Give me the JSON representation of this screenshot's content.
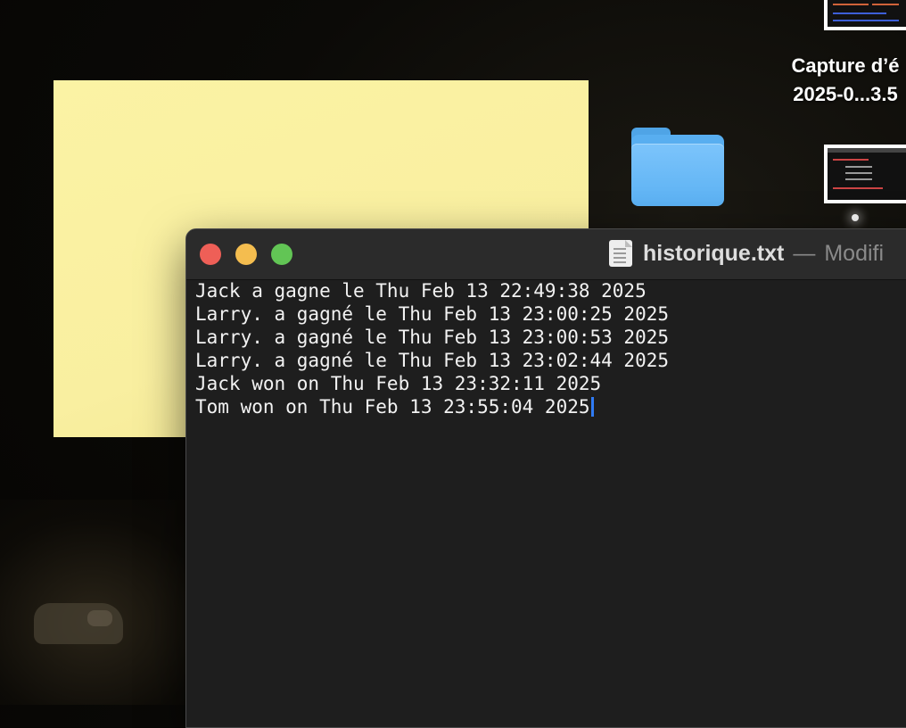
{
  "desktop": {
    "file_label_line1": "Capture d’é",
    "file_label_line2": "2025-0...3.5",
    "folder_icon": "folder-icon",
    "colors": {
      "sticky": "#fbf3a4",
      "folder": "#5bb1f3"
    }
  },
  "window": {
    "filename": "historique.txt",
    "separator": "—",
    "status": "Modifi",
    "controls": {
      "close": "close",
      "minimize": "minimize",
      "zoom": "zoom"
    },
    "lines": [
      "Jack a gagne le Thu Feb 13 22:49:38 2025",
      "Larry. a gagné le Thu Feb 13 23:00:25 2025",
      "Larry. a gagné le Thu Feb 13 23:00:53 2025",
      "Larry. a gagné le Thu Feb 13 23:02:44 2025",
      "Jack won on Thu Feb 13 23:32:11 2025",
      "Tom won on Thu Feb 13 23:55:04 2025"
    ],
    "colors": {
      "close": "#ee5f57",
      "minimize": "#f4bd4f",
      "zoom": "#62c555",
      "caret": "#2f7bf5"
    }
  }
}
